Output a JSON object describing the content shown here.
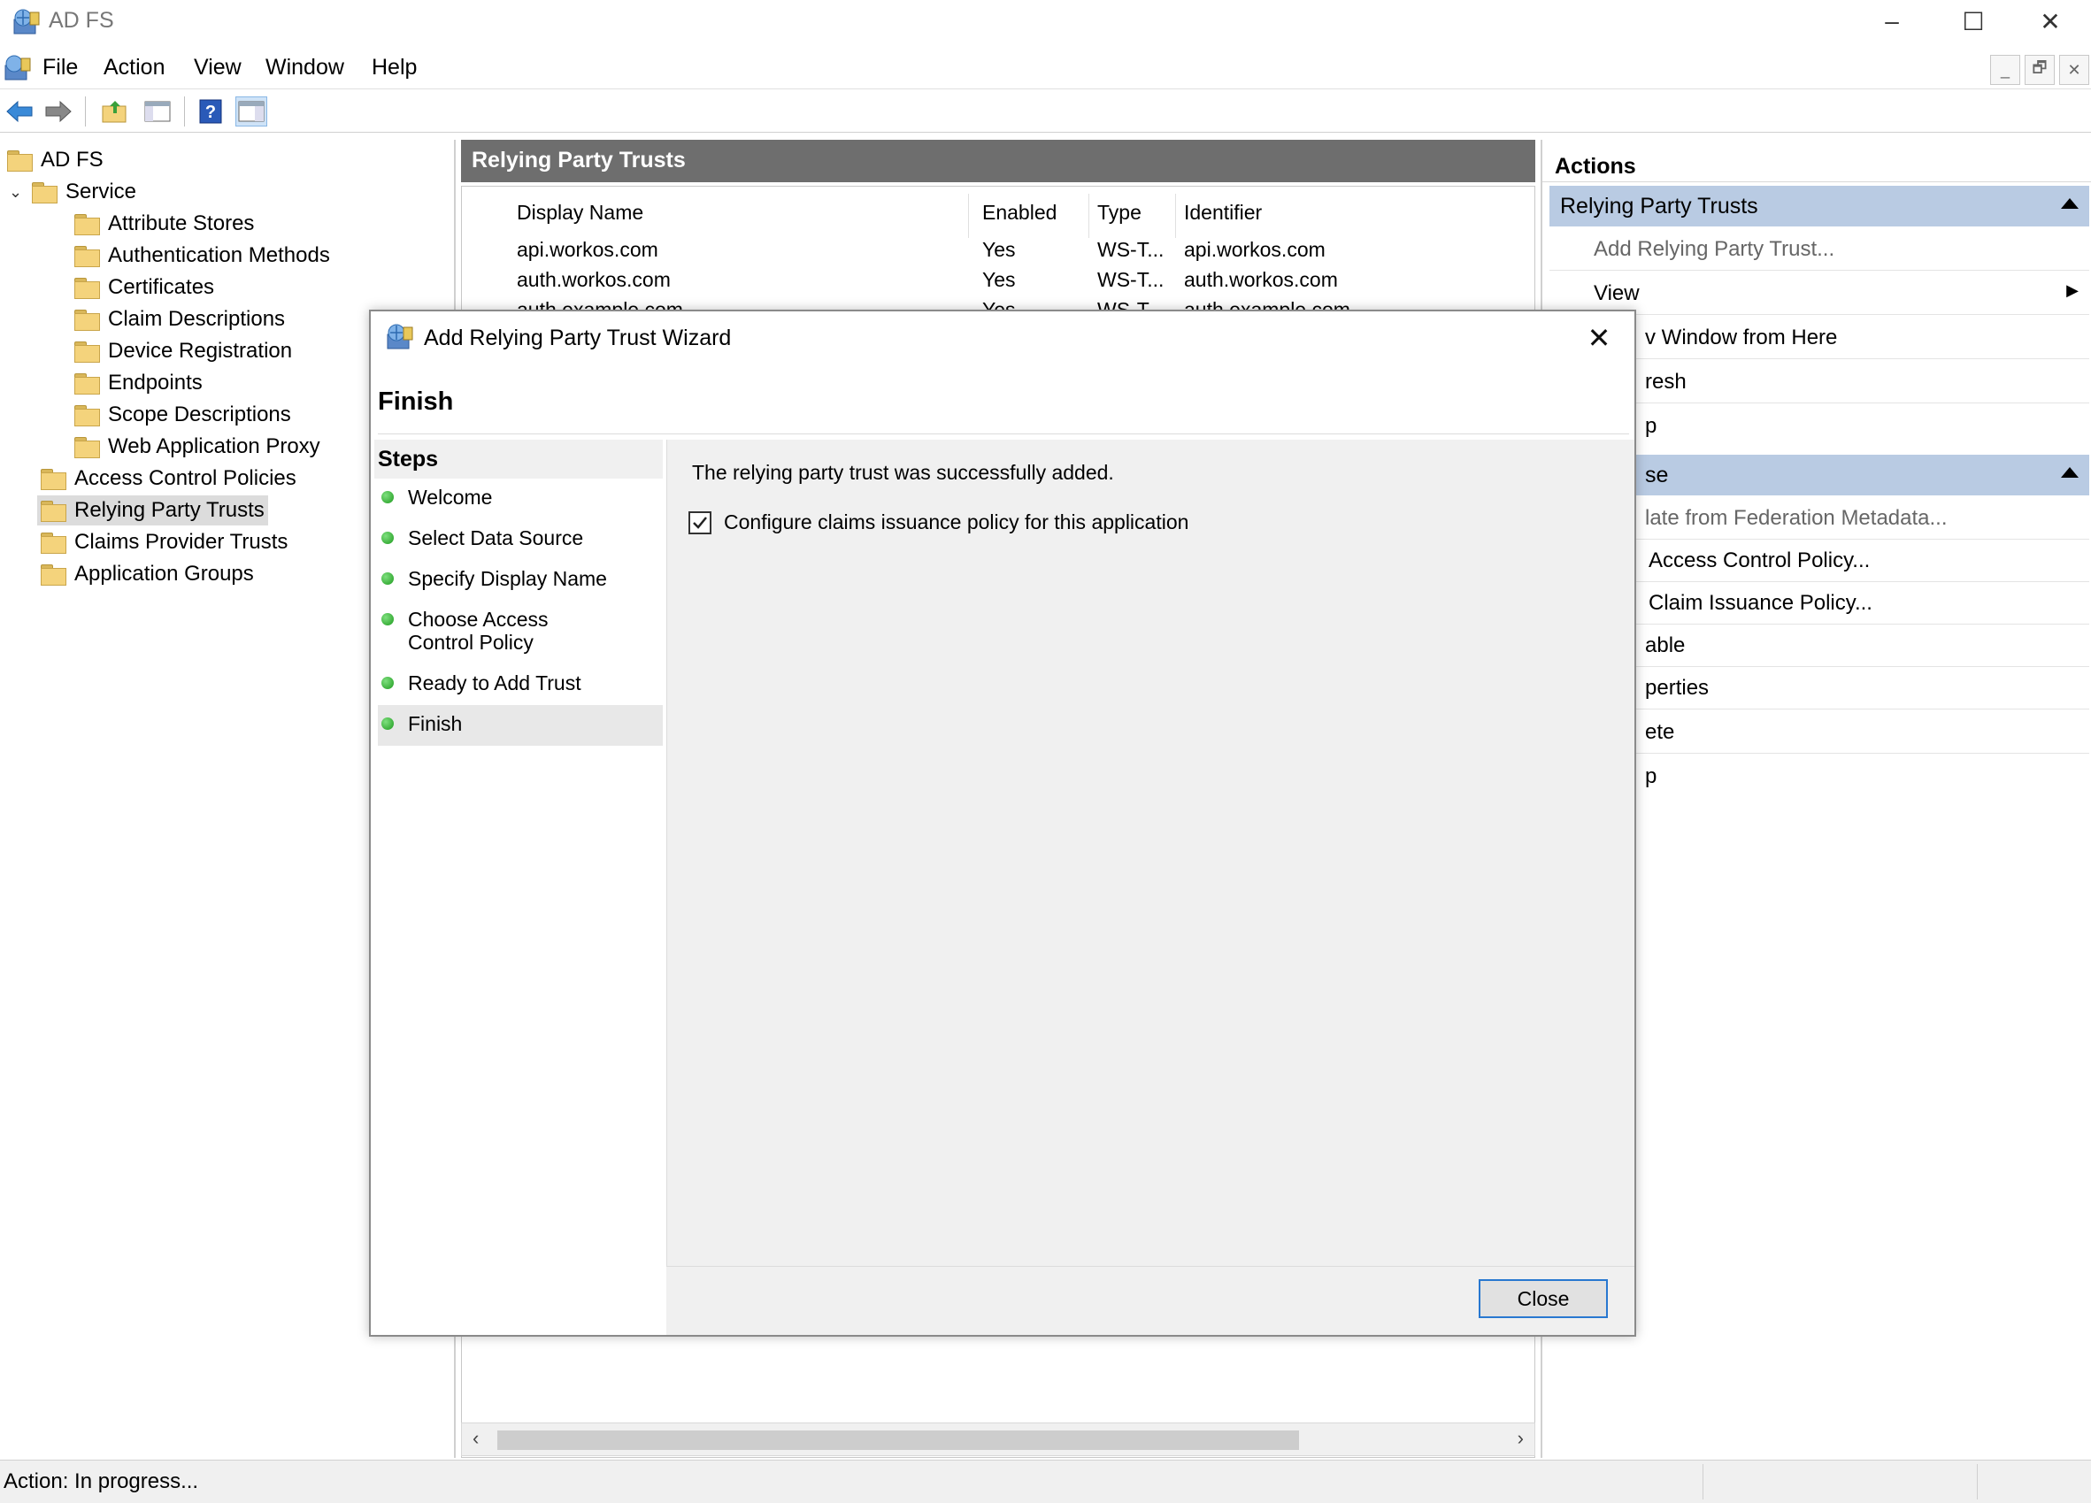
{
  "window": {
    "title": "AD FS",
    "controls": {
      "minimize": "–",
      "maximize": "☐",
      "close": "✕"
    }
  },
  "menu": [
    "File",
    "Action",
    "View",
    "Window",
    "Help"
  ],
  "mdi_controls": [
    "_",
    "🗗",
    "✕"
  ],
  "toolbar": {
    "icons": [
      "back-arrow-icon",
      "forward-arrow-icon",
      "up-folder-icon",
      "show-hide-tree-icon",
      "help-icon",
      "show-hide-action-pane-icon"
    ]
  },
  "tree": {
    "root": "AD FS",
    "service": "Service",
    "service_children": [
      "Attribute Stores",
      "Authentication Methods",
      "Certificates",
      "Claim Descriptions",
      "Device Registration",
      "Endpoints",
      "Scope Descriptions",
      "Web Application Proxy"
    ],
    "top_items": [
      "Access Control Policies",
      "Relying Party Trusts",
      "Claims Provider Trusts",
      "Application Groups"
    ],
    "selected": "Relying Party Trusts"
  },
  "center": {
    "title": "Relying Party Trusts",
    "columns": [
      "Display Name",
      "Enabled",
      "Type",
      "Identifier"
    ],
    "rows": [
      [
        "api.workos.com",
        "Yes",
        "WS-T...",
        "api.workos.com"
      ],
      [
        "auth.workos.com",
        "Yes",
        "WS-T...",
        "auth.workos.com"
      ],
      [
        "auth.example.com",
        "Yes",
        "WS-T...",
        "auth.example.com"
      ]
    ]
  },
  "actions": {
    "title": "Actions",
    "group1": "Relying Party Trusts",
    "group1_items": [
      "Add Relying Party Trust...",
      "View",
      "v Window from Here",
      "resh",
      "p"
    ],
    "group2": "se",
    "group2_items": [
      "late from Federation Metadata...",
      "Access Control Policy...",
      "Claim Issuance Policy...",
      "able",
      "perties",
      "ete",
      "p"
    ]
  },
  "status": {
    "text": "Action:  In progress..."
  },
  "wizard": {
    "title": "Add Relying Party Trust Wizard",
    "heading": "Finish",
    "steps_header": "Steps",
    "steps": [
      "Welcome",
      "Select Data Source",
      "Specify Display Name",
      "Choose Access Control Policy",
      "Ready to Add Trust",
      "Finish"
    ],
    "current_step": "Finish",
    "message": "The relying party trust was successfully added.",
    "checkbox_label": "Configure claims issuance policy for this application",
    "checkbox_checked": true,
    "close_button": "Close"
  },
  "colors": {
    "accent_blue": "#2878d0",
    "action_group_bg": "#b9cbe3",
    "center_header_bg": "#6e6e6e",
    "step_dot": "#1e9a1e"
  }
}
